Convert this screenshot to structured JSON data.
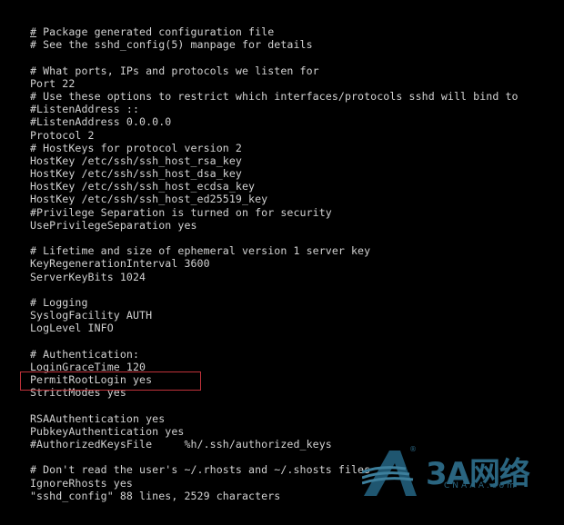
{
  "editor": {
    "file_name": "sshd_config",
    "lines": [
      "# Package generated configuration file",
      "# See the sshd_config(5) manpage for details",
      "",
      "# What ports, IPs and protocols we listen for",
      "Port 22",
      "# Use these options to restrict which interfaces/protocols sshd will bind to",
      "#ListenAddress ::",
      "#ListenAddress 0.0.0.0",
      "Protocol 2",
      "# HostKeys for protocol version 2",
      "HostKey /etc/ssh/ssh_host_rsa_key",
      "HostKey /etc/ssh/ssh_host_dsa_key",
      "HostKey /etc/ssh/ssh_host_ecdsa_key",
      "HostKey /etc/ssh/ssh_host_ed25519_key",
      "#Privilege Separation is turned on for security",
      "UsePrivilegeSeparation yes",
      "",
      "# Lifetime and size of ephemeral version 1 server key",
      "KeyRegenerationInterval 3600",
      "ServerKeyBits 1024",
      "",
      "# Logging",
      "SyslogFacility AUTH",
      "LogLevel INFO",
      "",
      "# Authentication:",
      "LoginGraceTime 120",
      "PermitRootLogin yes",
      "StrictModes yes",
      "",
      "RSAAuthentication yes",
      "PubkeyAuthentication yes",
      "#AuthorizedKeysFile     %h/.ssh/authorized_keys",
      "",
      "# Don't read the user's ~/.rhosts and ~/.shosts files",
      "IgnoreRhosts yes"
    ],
    "highlighted_line": "PermitRootLogin yes",
    "status_line": "\"sshd_config\" 88 lines, 2529 characters"
  },
  "annotation": {
    "color": "#c0323a"
  },
  "watermark": {
    "brand": "3A网络",
    "domain": "CNAAA.com",
    "registered": "®",
    "color": "#2a6580"
  }
}
